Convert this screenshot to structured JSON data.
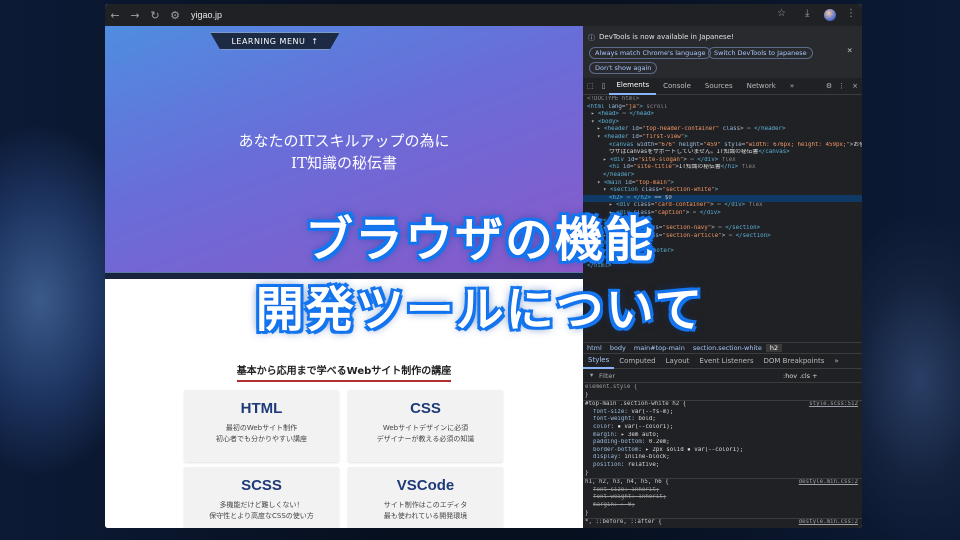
{
  "browser": {
    "url": "yigao.jp"
  },
  "site": {
    "menu_label": "LEARNING MENU",
    "tagline": "あなたのITスキルアップの為に",
    "site_title": "IT知識の秘伝書",
    "section_heading": "基本から応用まで学べるWebサイト制作の講座",
    "cards": [
      {
        "title": "HTML",
        "line1": "最初のWebサイト制作",
        "line2": "初心者でも分かりやすい講座"
      },
      {
        "title": "CSS",
        "line1": "Webサイトデザインに必須",
        "line2": "デザイナーが教える必須の知識"
      },
      {
        "title": "SCSS",
        "line1": "多機能だけど難しくない！",
        "line2": "保守性とより高度なCSSの使い方"
      },
      {
        "title": "VSCode",
        "line1": "サイト制作はこのエディタ",
        "line2": "最も使われている開発環境"
      }
    ]
  },
  "devtools": {
    "info_text": "DevTools is now available in Japanese!",
    "buttons": [
      "Always match Chrome's language",
      "Switch DevTools to Japanese",
      "Don't show again"
    ],
    "tabs": [
      "Elements",
      "Console",
      "Sources",
      "Network"
    ],
    "more": "»",
    "breadcrumbs": [
      "html",
      "body",
      "main#top-main",
      "section.section-white",
      "h2"
    ],
    "style_tabs": [
      "Styles",
      "Computed",
      "Layout",
      "Event Listeners",
      "DOM Breakpoints"
    ],
    "filter_placeholder": "Filter",
    "filter_tools": ":hov .cls +"
  },
  "overlay": {
    "line1": "ブラウザの機能",
    "line2": "開発ツールについて"
  }
}
